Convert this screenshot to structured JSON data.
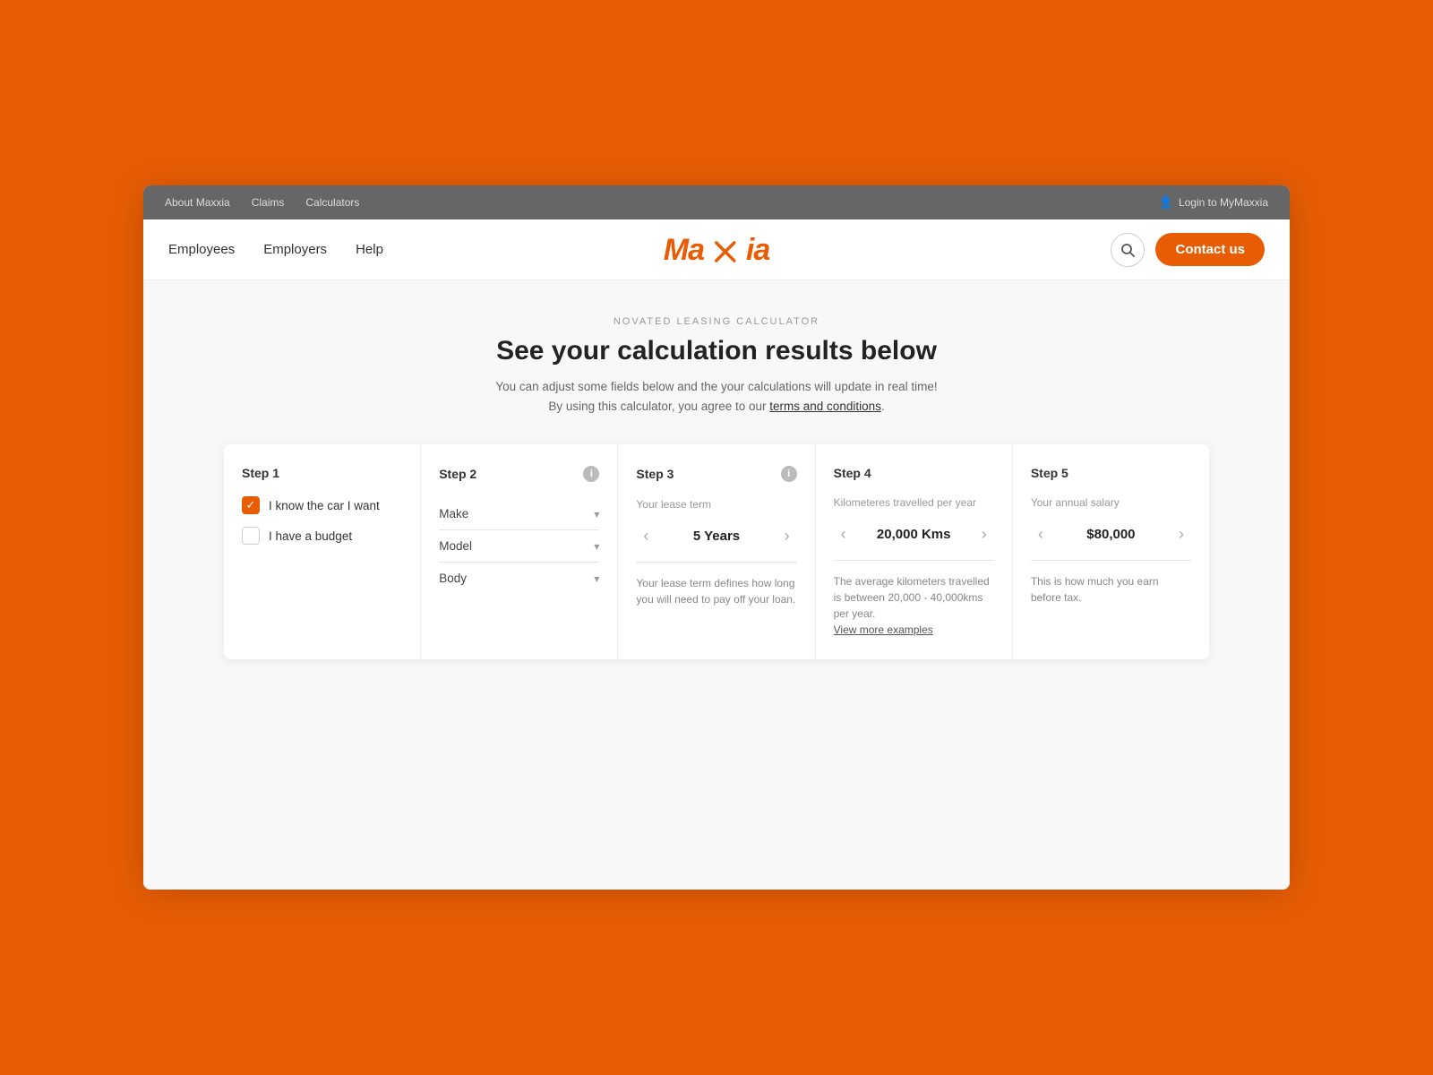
{
  "topBar": {
    "links": [
      "About Maxxia",
      "Claims",
      "Calculators"
    ],
    "loginText": "Login to MyMaxxia"
  },
  "nav": {
    "leftItems": [
      "Employees",
      "Employers",
      "Help"
    ],
    "logoText": "Maxxia",
    "searchLabel": "search",
    "contactLabel": "Contact us"
  },
  "calculatorSection": {
    "subtitle": "NOVATED LEASING CALCULATOR",
    "heading": "See your calculation results below",
    "description": "You can adjust some fields below and the your calculations will update in real time!",
    "description2": "By using this calculator, you agree to our",
    "termsLinkText": "terms and conditions",
    "descriptionEnd": "."
  },
  "steps": {
    "step1": {
      "title": "Step 1",
      "option1Label": "I know the car I want",
      "option1Checked": true,
      "option2Label": "I have a budget",
      "option2Checked": false
    },
    "step2": {
      "title": "Step 2",
      "infoIcon": "i",
      "dropdowns": [
        {
          "label": "Make"
        },
        {
          "label": "Model"
        },
        {
          "label": "Body"
        }
      ]
    },
    "step3": {
      "title": "Step 3",
      "infoIcon": "i",
      "sublabel": "Your lease term",
      "value": "5 Years",
      "description": "Your lease term defines how long you will need to pay off your loan."
    },
    "step4": {
      "title": "Step 4",
      "sublabel": "Kilometeres travelled per year",
      "value": "20,000 Kms",
      "description": "The average kilometers travelled is between 20,000 - 40,000kms per year.",
      "linkText": "View more examples"
    },
    "step5": {
      "title": "Step 5",
      "sublabel": "Your annual salary",
      "value": "$80,000",
      "description": "This is how much you earn before tax."
    }
  }
}
